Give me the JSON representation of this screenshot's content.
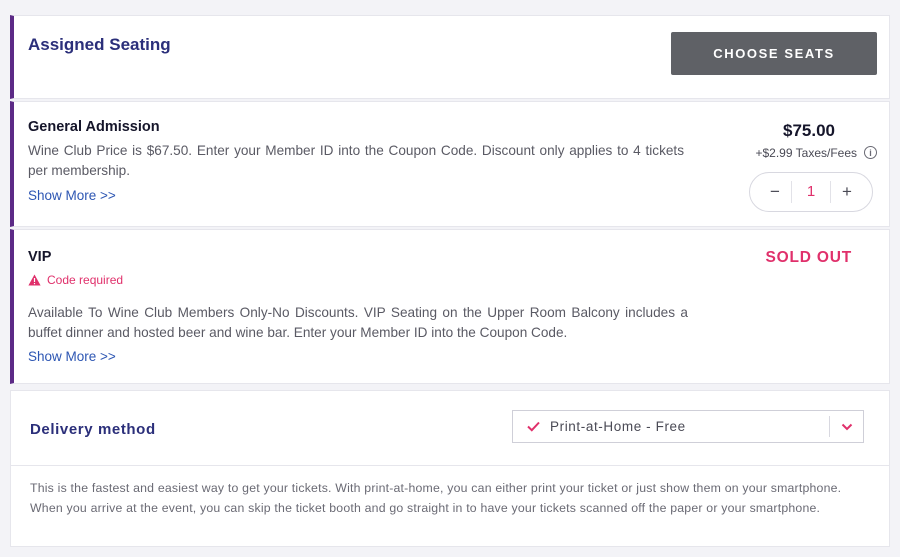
{
  "seating": {
    "title": "Assigned Seating",
    "choose_label": "CHOOSE SEATS"
  },
  "tickets": [
    {
      "name": "General Admission",
      "description": "Wine Club Price is $67.50. Enter your Member ID into the Coupon Code. Discount only applies to 4 tickets per membership.",
      "show_more": "Show More >>",
      "price": "$75.00",
      "fees": "+$2.99 Taxes/Fees",
      "quantity": "1",
      "minus": "−",
      "plus": "+"
    },
    {
      "name": "VIP",
      "code_required": "Code required",
      "description": "Available To Wine Club Members Only-No Discounts. VIP Seating on the Upper Room Balcony includes a buffet dinner and hosted beer and wine bar. Enter your Member ID into the Coupon Code.",
      "show_more": "Show More >>",
      "status": "SOLD OUT"
    }
  ],
  "delivery": {
    "label": "Delivery method",
    "selected": "Print-at-Home - Free",
    "note": "This is the fastest and easiest way to get your tickets. With print-at-home, you can either print your ticket or just show them on your smartphone. When you arrive at the event, you can skip the ticket booth and go straight in to have your tickets scanned off the paper or your smartphone."
  },
  "icons": {
    "info": "info-icon",
    "warning": "warning-icon",
    "check": "check-icon",
    "chevron": "chevron-down-icon"
  },
  "colors": {
    "accent": "#5c2a86",
    "heading": "#2b2f7a",
    "pink": "#e0306b",
    "link": "#2d56b3",
    "button": "#5f6166"
  }
}
